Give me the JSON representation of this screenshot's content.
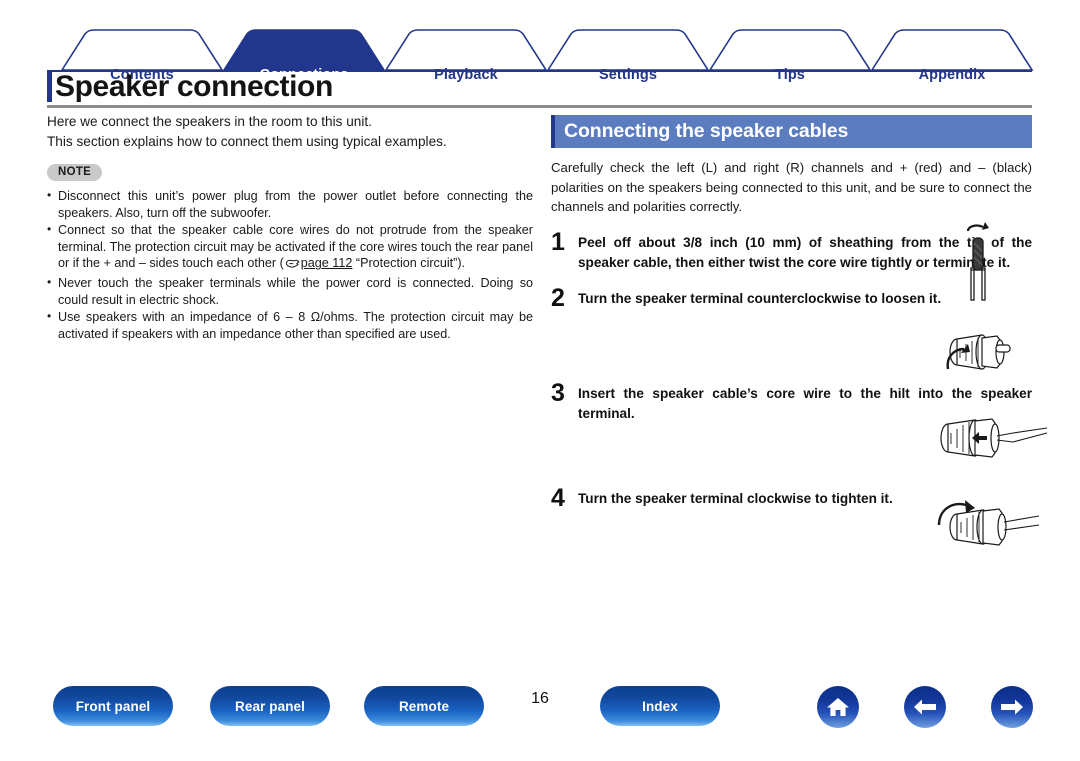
{
  "tabs": [
    {
      "label": "Contents",
      "active": false
    },
    {
      "label": "Connections",
      "active": true
    },
    {
      "label": "Playback",
      "active": false
    },
    {
      "label": "Settings",
      "active": false
    },
    {
      "label": "Tips",
      "active": false
    },
    {
      "label": "Appendix",
      "active": false
    }
  ],
  "page": {
    "title": "Speaker connection",
    "number": "16"
  },
  "left": {
    "intro_line1": "Here we connect the speakers in the room to this unit.",
    "intro_line2": "This section explains how to connect them using typical examples.",
    "note_badge": "NOTE",
    "notes": [
      {
        "text": "Disconnect this unit’s power plug from the power outlet before connecting the speakers. Also, turn off the subwoofer."
      },
      {
        "pre": "Connect so that the speaker cable core wires do not protrude from the speaker terminal. The protection circuit may be activated if the core wires touch the rear panel or if the + and – sides touch each other (",
        "link": "page 112",
        "post": " “Protection circuit”)."
      },
      {
        "text": "Never touch the speaker terminals while the power cord is connected. Doing so could result in electric shock."
      },
      {
        "text": "Use speakers with an impedance of 6 – 8 Ω/ohms. The protection circuit may be activated if speakers with an impedance other than specified are used."
      }
    ]
  },
  "right": {
    "heading": "Connecting the speaker cables",
    "intro": "Carefully check the left (L) and right (R) channels and + (red) and – (black) polarities on the speakers being connected to this unit, and be sure to connect the channels and polarities correctly.",
    "steps": [
      {
        "num": "1",
        "text": "Peel off about 3/8 inch (10 mm) of sheathing from the tip of the speaker cable, then either twist the core wire tightly or terminate it.",
        "figure": "speaker-cable-twist-figure"
      },
      {
        "num": "2",
        "text": "Turn the speaker terminal counterclockwise to loosen it.",
        "figure": "terminal-loosen-figure"
      },
      {
        "num": "3",
        "text": "Insert the speaker cable’s core wire to the hilt into the speaker terminal.",
        "figure": "terminal-insert-figure"
      },
      {
        "num": "4",
        "text": "Turn the speaker terminal clockwise to tighten it.",
        "figure": "terminal-tighten-figure"
      }
    ]
  },
  "footer": {
    "buttons": [
      {
        "label": "Front panel"
      },
      {
        "label": "Rear panel"
      },
      {
        "label": "Remote"
      },
      {
        "label": "Index"
      }
    ],
    "nav_icons": [
      {
        "name": "home-icon"
      },
      {
        "name": "arrow-left-icon"
      },
      {
        "name": "arrow-right-icon"
      }
    ]
  },
  "colors": {
    "navy": "#22368c",
    "active_tab": "#22368c",
    "heading_bar": "#5c7cc0",
    "note_badge": "#c9c9c9",
    "rule": "#8c8c8c"
  }
}
